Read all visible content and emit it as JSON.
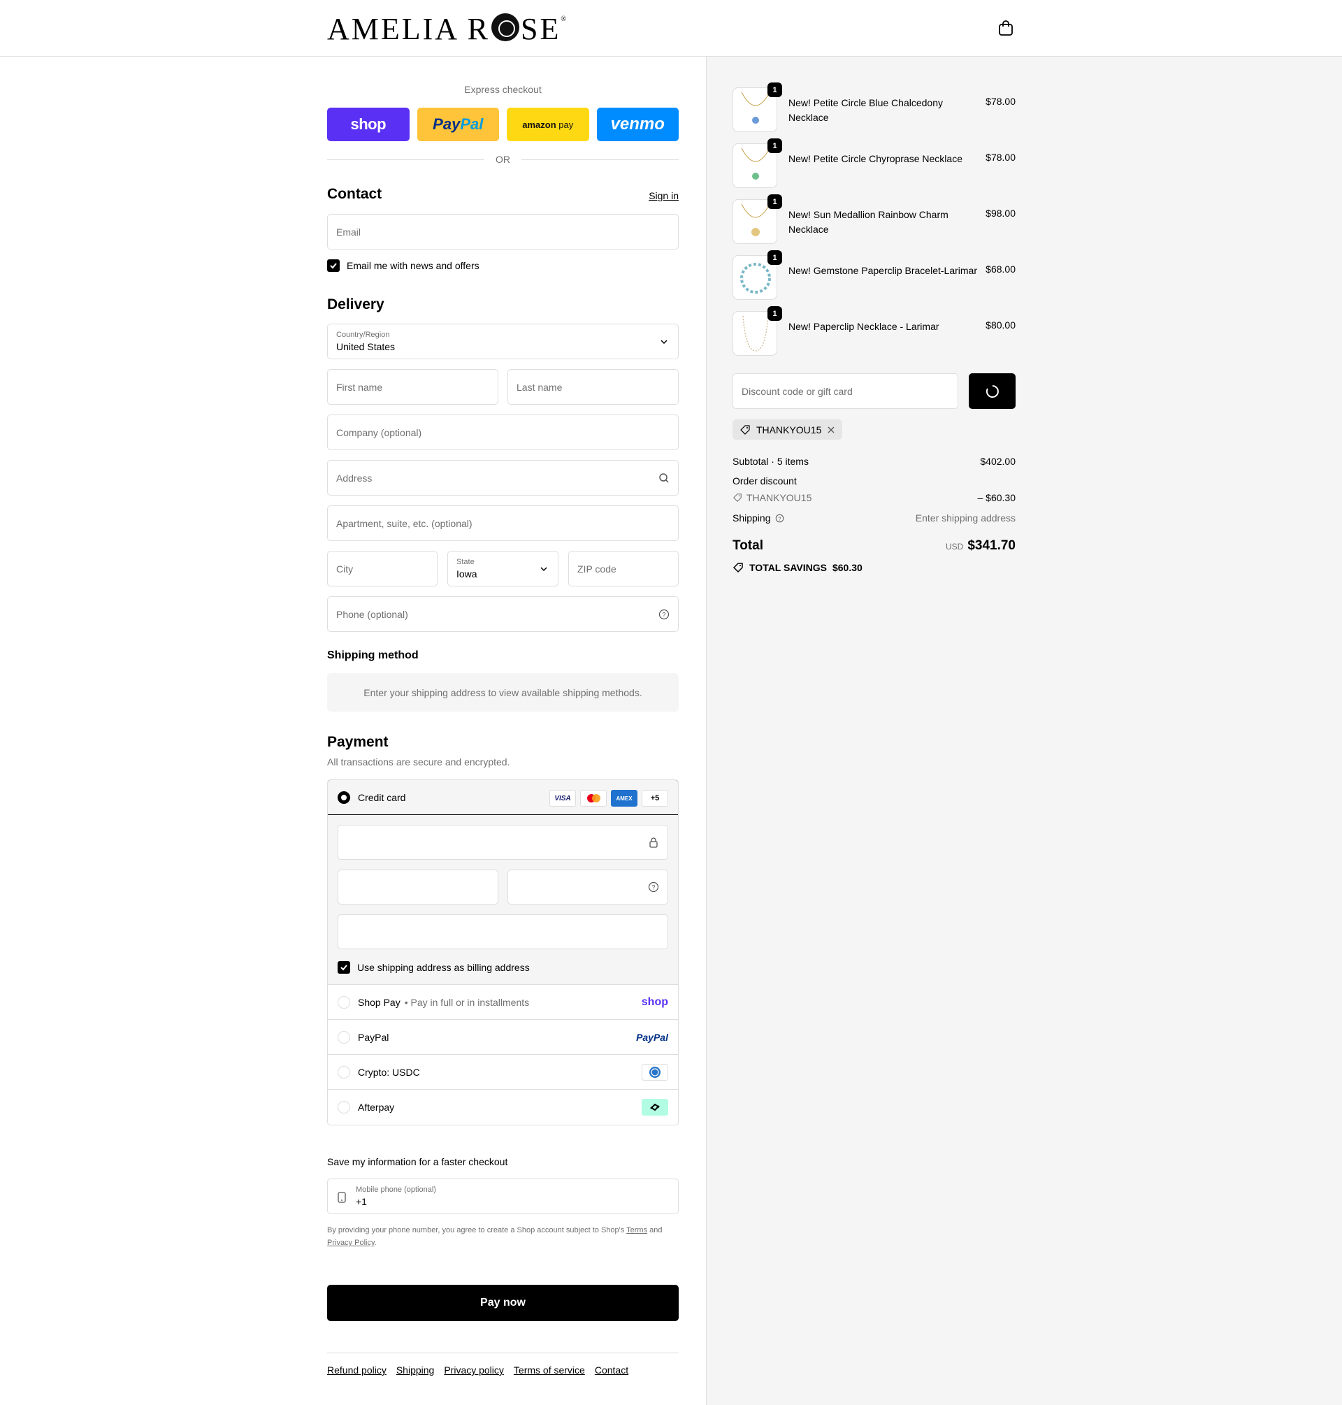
{
  "header": {
    "brand_left": "AMELIA R",
    "brand_right": "SE",
    "brand_reg": "®"
  },
  "express": {
    "label": "Express checkout",
    "buttons": [
      "shop",
      "Pay",
      "Pal",
      "amazon",
      "pay",
      "venmo"
    ],
    "or_label": "OR"
  },
  "contact": {
    "title": "Contact",
    "sign_in": "Sign in",
    "email_placeholder": "Email",
    "news_label": "Email me with news and offers"
  },
  "delivery": {
    "title": "Delivery",
    "country_label": "Country/Region",
    "country_value": "United States",
    "first_name": "First name",
    "last_name": "Last name",
    "company": "Company (optional)",
    "address": "Address",
    "apartment": "Apartment, suite, etc. (optional)",
    "city": "City",
    "state_label": "State",
    "state_value": "Iowa",
    "zip": "ZIP code",
    "phone": "Phone (optional)"
  },
  "shipping_method": {
    "title": "Shipping method",
    "message": "Enter your shipping address to view available shipping methods."
  },
  "payment": {
    "title": "Payment",
    "subtitle": "All transactions are secure and encrypted.",
    "credit_card_label": "Credit card",
    "card_brands": [
      "VISA",
      "AMEX",
      "+5"
    ],
    "billing_label": "Use shipping address as billing address",
    "options": [
      {
        "label": "Shop Pay",
        "sub": "• Pay in full or in installments",
        "brand": "shop"
      },
      {
        "label": "PayPal",
        "brand": "PayPal"
      },
      {
        "label": "Crypto: USDC",
        "brand": "usdc-icon"
      },
      {
        "label": "Afterpay",
        "brand": "afterpay-icon"
      }
    ]
  },
  "save_info": {
    "title": "Save my information for a faster checkout",
    "phone_label": "Mobile phone (optional)",
    "phone_value": "+1",
    "legal_prefix": "By providing your phone number, you agree to create a Shop account subject to Shop's",
    "terms": "Terms",
    "and": "and",
    "privacy": "Privacy Policy",
    "period": "."
  },
  "pay_now": "Pay now",
  "footer_links": [
    "Refund policy",
    "Shipping",
    "Privacy policy",
    "Terms of service",
    "Contact"
  ],
  "summary": {
    "items": [
      {
        "name": "New! Petite Circle Blue Chalcedony Necklace",
        "price": "$78.00",
        "qty": "1",
        "gem": "#6a9bd8"
      },
      {
        "name": "New! Petite Circle Chyroprase Necklace",
        "price": "$78.00",
        "qty": "1",
        "gem": "#6dc08c"
      },
      {
        "name": "New! Sun Medallion Rainbow Charm Necklace",
        "price": "$98.00",
        "qty": "1",
        "gem": "#e3c77e"
      },
      {
        "name": "New! Gemstone Paperclip Bracelet-Larimar",
        "price": "$68.00",
        "qty": "1",
        "gem": "#7ab8c8"
      },
      {
        "name": "New! Paperclip Necklace - Larimar",
        "price": "$80.00",
        "qty": "1",
        "gem": "#c9b28a"
      }
    ],
    "discount_placeholder": "Discount code or gift card",
    "applied_code": "THANKYOU15",
    "subtotal_label": "Subtotal · 5 items",
    "subtotal_value": "$402.00",
    "order_discount_label": "Order discount",
    "discount_code": "THANKYOU15",
    "discount_value": "– $60.30",
    "shipping_label": "Shipping",
    "shipping_value": "Enter shipping address",
    "total_label": "Total",
    "currency": "USD",
    "total_value": "$341.70",
    "savings_label": "TOTAL SAVINGS",
    "savings_value": "$60.30"
  }
}
